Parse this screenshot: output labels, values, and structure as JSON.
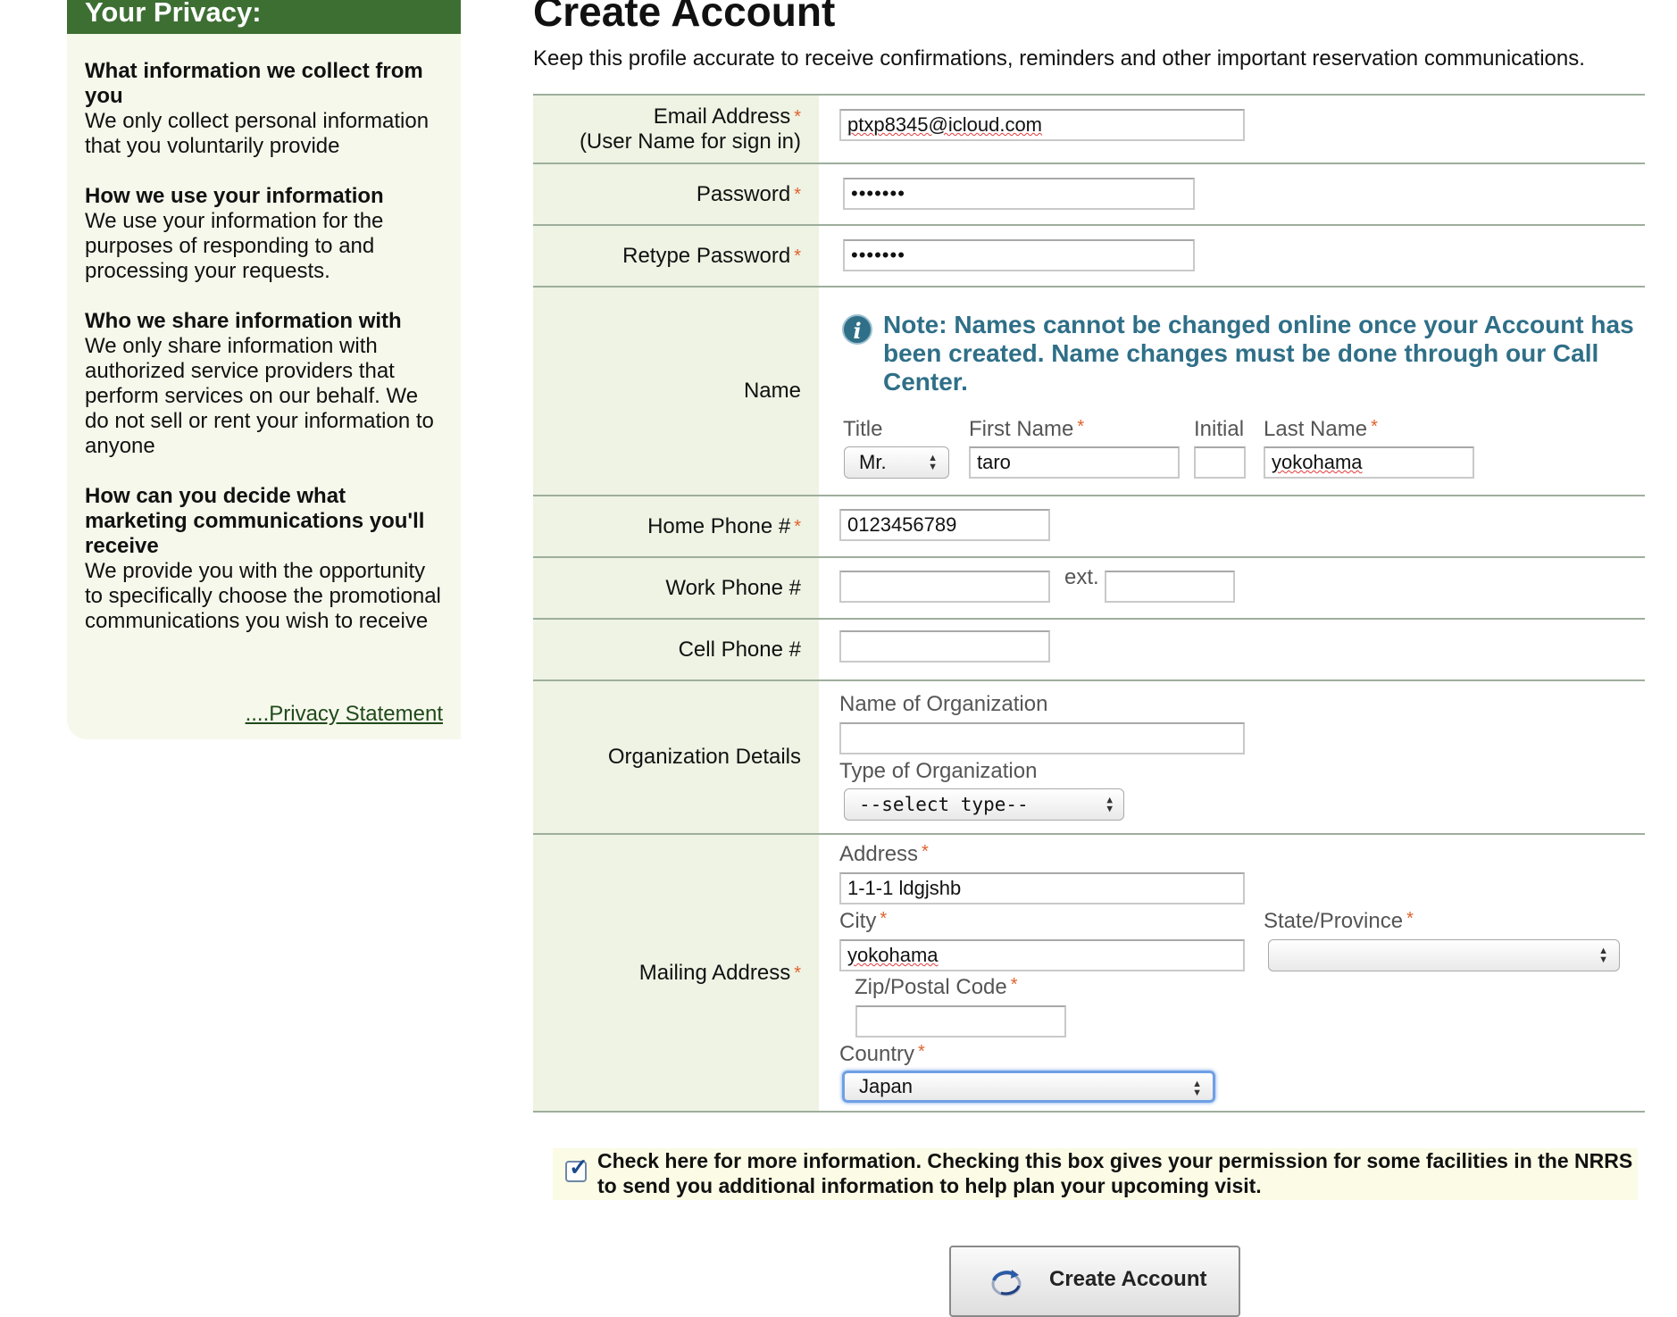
{
  "privacy": {
    "title": "Your Privacy:",
    "sections": [
      {
        "q": "What information we collect from you",
        "a": "We only collect personal information that you voluntarily provide"
      },
      {
        "q": "How we use your information",
        "a": "We use your information for the purposes of responding to and processing your requests."
      },
      {
        "q": "Who we share information with",
        "a": "We only share information with authorized service providers that perform services on our behalf. We do not sell or rent your information to anyone"
      },
      {
        "q": "How can you decide what marketing communications you'll receive",
        "a": "We provide you with the opportunity to specifically choose the promotional communications you wish to receive"
      }
    ],
    "link": "....Privacy Statement"
  },
  "form": {
    "title": "Create Account",
    "subtitle": "Keep this profile accurate to receive confirmations, reminders and other important reservation communications.",
    "required_marker": "*",
    "email": {
      "label1": "Email Address",
      "label2": "(User Name for sign in)",
      "value": "ptxp8345@icloud.com"
    },
    "password": {
      "label": "Password",
      "value": "•••••••"
    },
    "retype": {
      "label": "Retype Password",
      "value": "•••••••"
    },
    "name": {
      "label": "Name",
      "note": "Note: Names cannot be changed online once your Account has been created. Name changes must be done through our Call Center.",
      "title_label": "Title",
      "title_value": "Mr.",
      "first_label": "First Name",
      "first_value": "taro",
      "initial_label": "Initial",
      "initial_value": "",
      "last_label": "Last Name",
      "last_value": "yokohama"
    },
    "home_phone": {
      "label": "Home Phone #",
      "value": "0123456789"
    },
    "work_phone": {
      "label": "Work Phone #",
      "value": "",
      "ext_label": "ext.",
      "ext_value": ""
    },
    "cell_phone": {
      "label": "Cell Phone #",
      "value": ""
    },
    "org": {
      "label": "Organization Details",
      "name_label": "Name of Organization",
      "name_value": "",
      "type_label": "Type of Organization",
      "type_value": "--select type--"
    },
    "mailing": {
      "label": "Mailing Address",
      "address_label": "Address",
      "address_value": "1-1-1 ldgjshb",
      "city_label": "City",
      "city_value": "yokohama",
      "state_label": "State/Province",
      "state_value": "",
      "zip_label": "Zip/Postal Code",
      "zip_value": "",
      "country_label": "Country",
      "country_value": "Japan"
    },
    "optin": {
      "checked": true,
      "text": "Check here for more information. Checking this box gives your permission for some facilities in the NRRS to send you additional information to help plan your upcoming visit."
    },
    "submit_label": "Create Account"
  },
  "colors": {
    "privacy_header": "#3d6f33",
    "label_bg": "#eef3e4",
    "note": "#2f6f88",
    "required": "#e0612b"
  }
}
